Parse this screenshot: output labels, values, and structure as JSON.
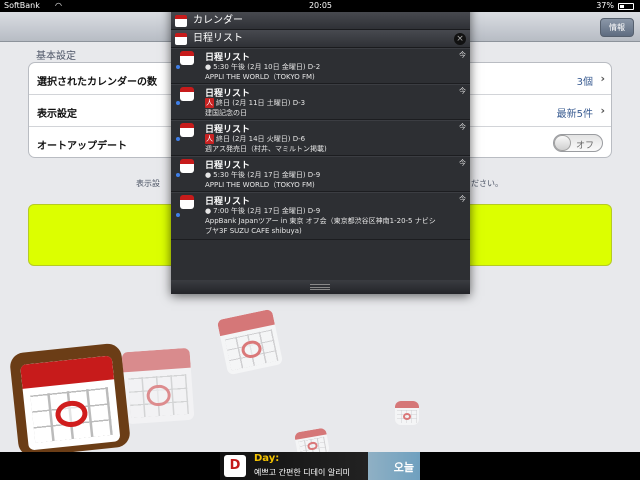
{
  "status_bar": {
    "carrier": "SoftBank",
    "time": "20:05",
    "battery": "37%",
    "battery_fraction": 0.37
  },
  "nav": {
    "info_label": "情報"
  },
  "settings": {
    "section_title": "基本設定",
    "rows": [
      {
        "label": "選択されたカレンダーの数",
        "value": "3個"
      },
      {
        "label": "表示設定",
        "value": "最新5件"
      },
      {
        "label": "オートアップデート",
        "value": "オフ"
      }
    ],
    "description_left": "表示設",
    "description_right": "ださい。"
  },
  "notification_center": {
    "time": "20:05",
    "calendar_header": "カレンダー",
    "widget_header": "日程リスト",
    "items": [
      {
        "title": "日程リスト",
        "tag": "今",
        "line1": "5:30 午後 (2月 10日 金曜日) D-2",
        "line2": "APPLI THE WORLD（TOKYO FM)",
        "glyph": "●"
      },
      {
        "title": "日程リスト",
        "tag": "今",
        "line1": "終日 (2月 11日 土曜日) D-3",
        "line2": "建国記念の日",
        "glyph": "人"
      },
      {
        "title": "日程リスト",
        "tag": "今",
        "line1": "終日 (2月 14日 火曜日) D-6",
        "line2": "週アス発売日（村井、マミルトン掲載)",
        "glyph": "人"
      },
      {
        "title": "日程リスト",
        "tag": "今",
        "line1": "5:30 午後 (2月 17日 金曜日) D-9",
        "line2": "APPLI THE WORLD（TOKYO FM)",
        "glyph": "●"
      },
      {
        "title": "日程リスト",
        "tag": "今",
        "line1": "7:00 午後 (2月 17日 金曜日) D-9",
        "line2": "AppBank Japanツアー in 東京 オフ会（東京都渋谷区神南1-20-5 ナビシ",
        "line3": "ブヤ3F SUZU CAFE shibuya)",
        "glyph": "●"
      }
    ]
  },
  "ad": {
    "logo": "D",
    "title": "Day:",
    "subtitle": "예쁘고 간편한 디데이 알리미",
    "right_text": "오늘"
  },
  "colors": {
    "accent_yellow": "#dcff00",
    "calendar_red": "#c71b1b",
    "unread_dot": "#3f7fe8"
  },
  "icons": [
    "wifi-icon",
    "battery-icon",
    "calendar-icon",
    "close-icon",
    "chevron-right-icon",
    "grabber-icon"
  ]
}
